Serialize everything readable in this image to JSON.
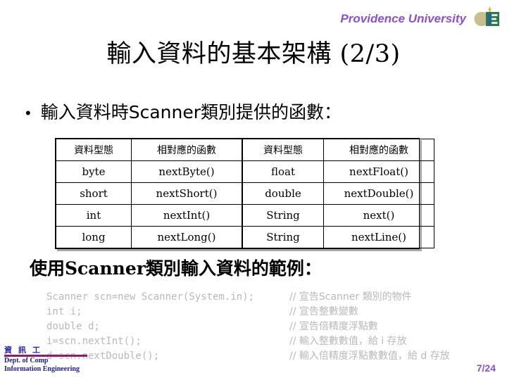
{
  "header": {
    "brand": "Providence University",
    "logo_icon": "providence-university-crest-icon"
  },
  "title": "輸入資料的基本架構 (2/3)",
  "bullet": {
    "marker": "•",
    "text": "輸入資料時Scanner類別提供的函數："
  },
  "table": {
    "headers": [
      "資料型態",
      "相對應的函數",
      "資料型態",
      "相對應的函數"
    ],
    "rows": [
      [
        "byte",
        "nextByte()",
        "float",
        "nextFloat()"
      ],
      [
        "short",
        "nextShort()",
        "double",
        "nextDouble()"
      ],
      [
        "int",
        "nextInt()",
        "String",
        "next()"
      ],
      [
        "long",
        "nextLong()",
        "String",
        "nextLine()"
      ]
    ]
  },
  "example_caption": "使用Scanner類別輸入資料的範例：",
  "code": {
    "lines": [
      {
        "src": "Scanner scn=new Scanner(System.in);",
        "comment": "// 宣告Scanner 類別的物件"
      },
      {
        "src": "int i;",
        "comment": "// 宣告整數變數"
      },
      {
        "src": "double d;",
        "comment": "// 宣告倍精度浮點數"
      },
      {
        "src": "i=scn.nextInt();",
        "comment": "// 輸入整數數值，給 i 存放"
      },
      {
        "src": "d=scn.nextDouble();",
        "comment": "// 輸入倍精度浮點數數值，給 d 存放"
      }
    ]
  },
  "footer": {
    "dept_cn": "資訊工",
    "dept_en_line1": "Dept. of Comp",
    "dept_en_line2": "Information Engineering",
    "page_number": "7/24"
  },
  "colors": {
    "brand_purple": "#8d4fd0",
    "footer_blue": "#1c1c8c",
    "footer_rule": "#8e1b6b",
    "code_gray": "#b9b9b9"
  }
}
